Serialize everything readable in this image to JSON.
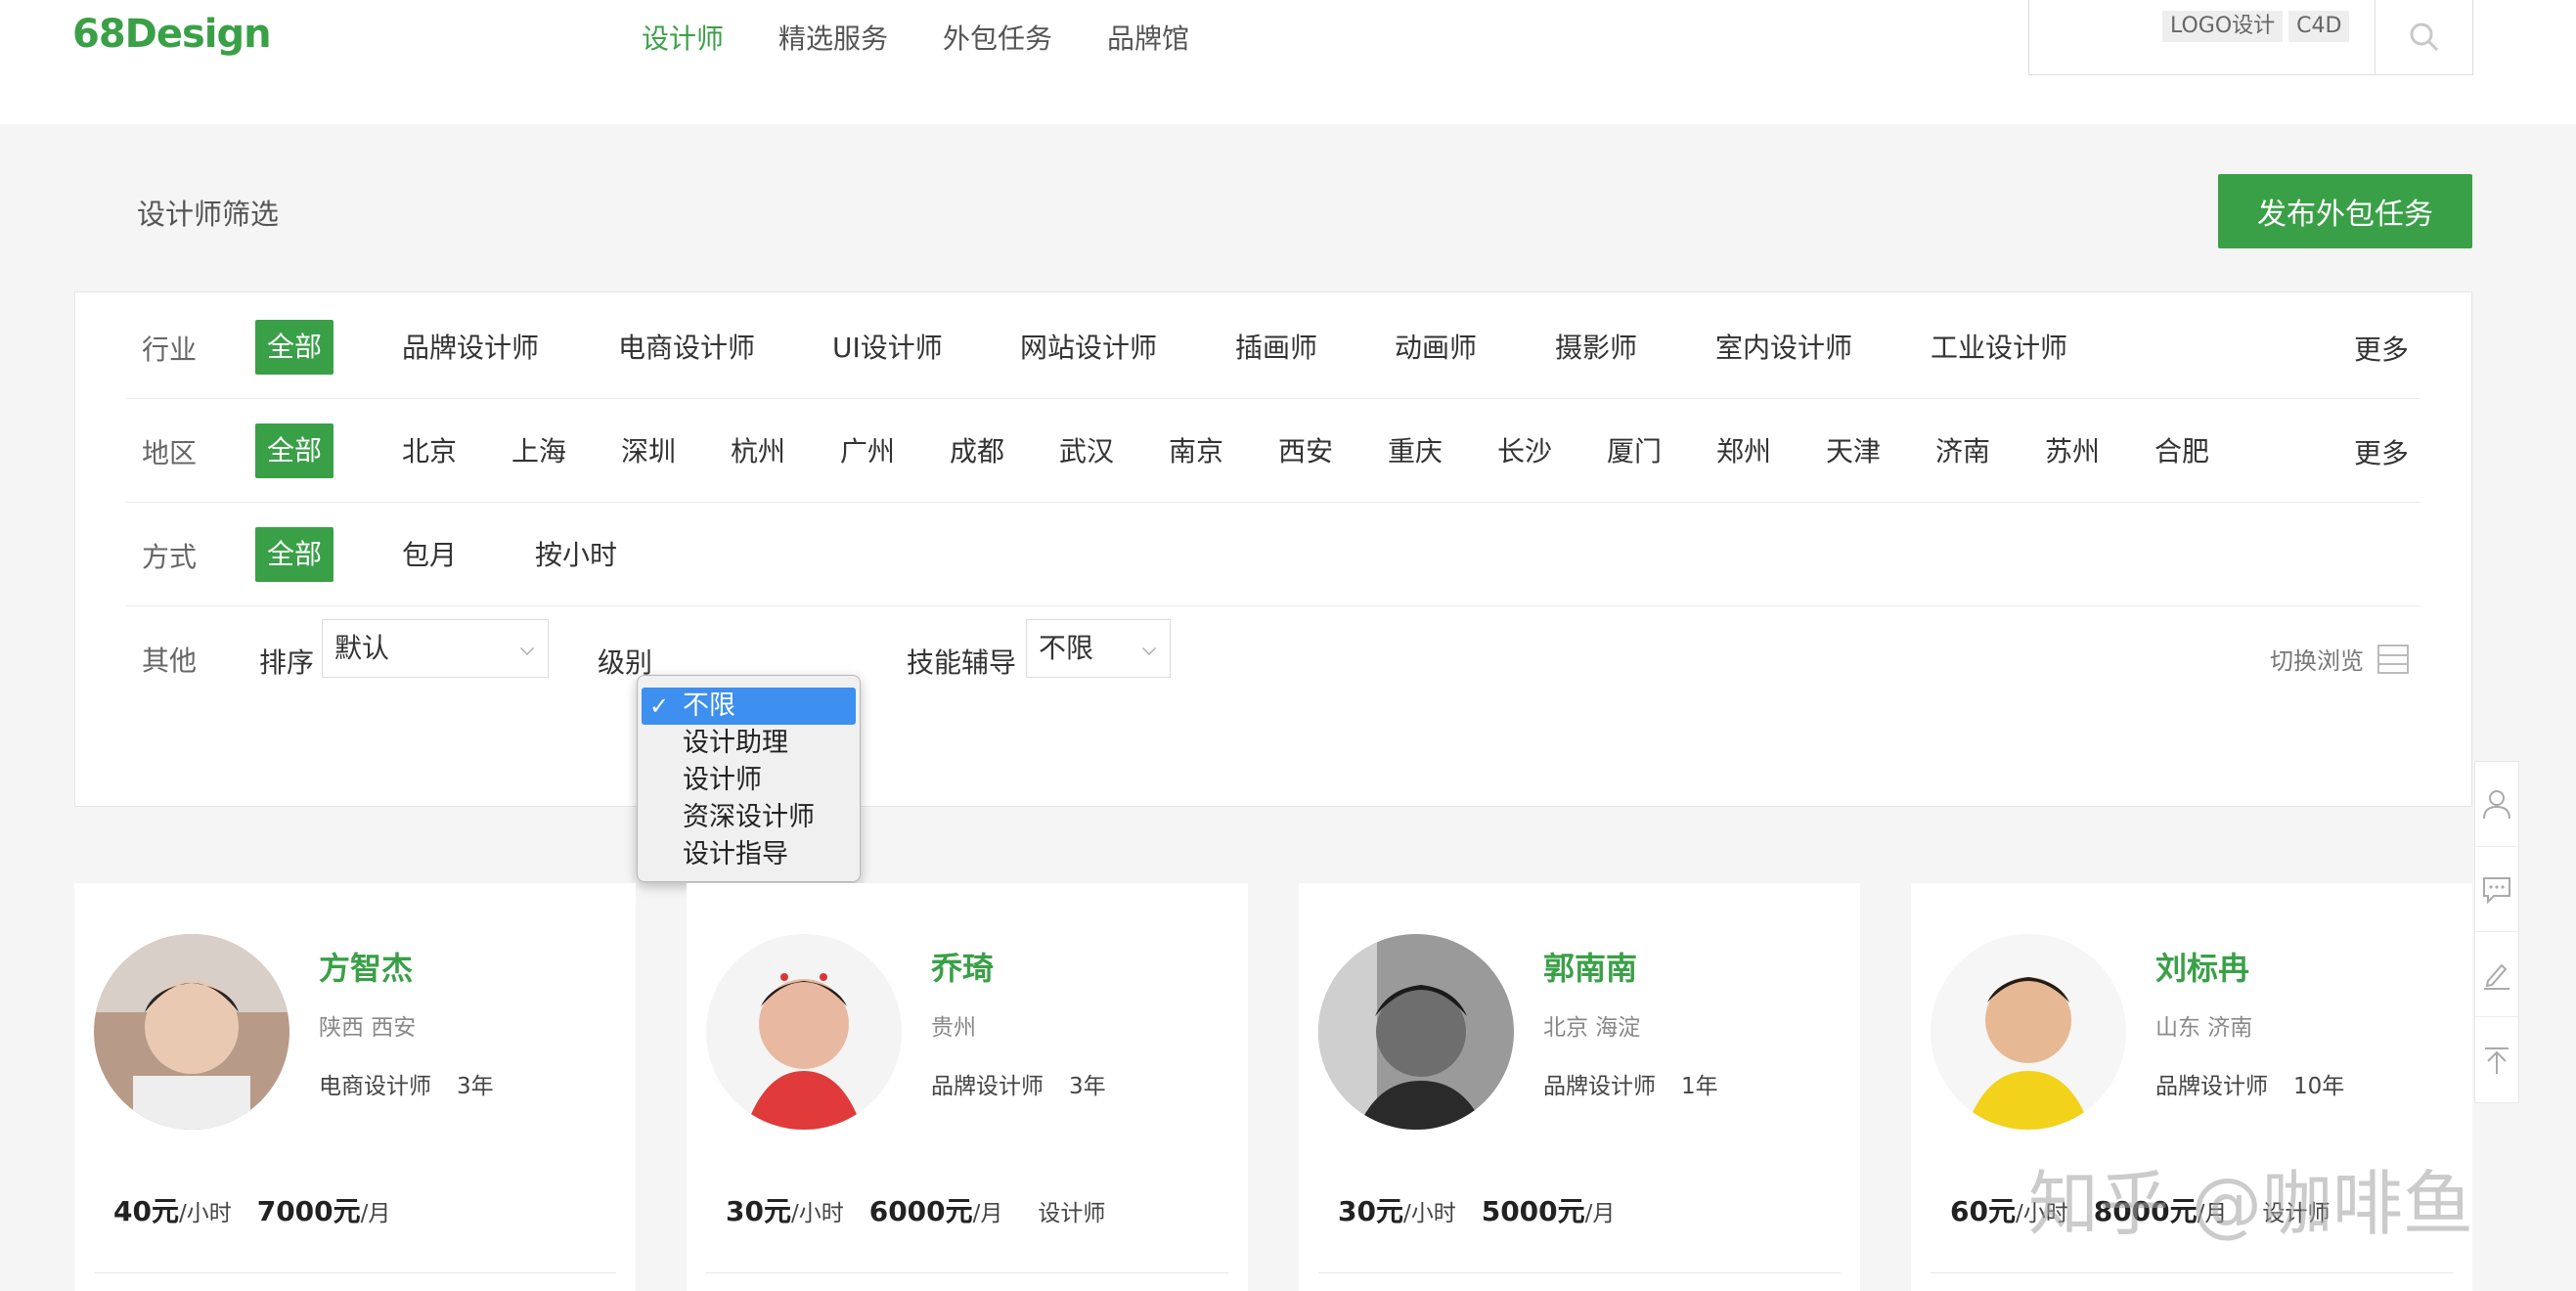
{
  "brand": {
    "logo": "68Design"
  },
  "nav": [
    "设计师",
    "精选服务",
    "外包任务",
    "品牌馆"
  ],
  "search": {
    "hot_tags": [
      "LOGO设计",
      "C4D"
    ]
  },
  "filter_title": "设计师筛选",
  "publish_button": "发布外包任务",
  "filters": {
    "industry": {
      "label": "行业",
      "all": "全部",
      "options": [
        "品牌设计师",
        "电商设计师",
        "UI设计师",
        "网站设计师",
        "插画师",
        "动画师",
        "摄影师",
        "室内设计师",
        "工业设计师"
      ],
      "more": "更多"
    },
    "region": {
      "label": "地区",
      "all": "全部",
      "options": [
        "北京",
        "上海",
        "深圳",
        "杭州",
        "广州",
        "成都",
        "武汉",
        "南京",
        "西安",
        "重庆",
        "长沙",
        "厦门",
        "郑州",
        "天津",
        "济南",
        "苏州",
        "合肥"
      ],
      "more": "更多"
    },
    "mode": {
      "label": "方式",
      "all": "全部",
      "options": [
        "包月",
        "按小时"
      ]
    },
    "other": {
      "label": "其他",
      "sort_label": "排序",
      "sort_value": "默认",
      "level_label": "级别",
      "skill_label": "技能辅导",
      "skill_value": "不限",
      "switch_view": "切换浏览"
    }
  },
  "level_dropdown": {
    "selected": "不限",
    "options": [
      "不限",
      "设计助理",
      "设计师",
      "资深设计师",
      "设计指导"
    ]
  },
  "cards": [
    {
      "name": "方智杰",
      "location": "陕西 西安",
      "role": "电商设计师",
      "years": "3年",
      "hourly": "40元",
      "hourly_unit": "/小时",
      "monthly": "7000元",
      "monthly_unit": "/月",
      "level": ""
    },
    {
      "name": "乔琦",
      "location": "贵州",
      "role": "品牌设计师",
      "years": "3年",
      "hourly": "30元",
      "hourly_unit": "/小时",
      "monthly": "6000元",
      "monthly_unit": "/月",
      "level": "设计师"
    },
    {
      "name": "郭南南",
      "location": "北京 海淀",
      "role": "品牌设计师",
      "years": "1年",
      "hourly": "30元",
      "hourly_unit": "/小时",
      "monthly": "5000元",
      "monthly_unit": "/月",
      "level": ""
    },
    {
      "name": "刘标冉",
      "location": "山东 济南",
      "role": "品牌设计师",
      "years": "10年",
      "hourly": "60元",
      "hourly_unit": "/小时",
      "monthly": "8000元",
      "monthly_unit": "/月",
      "level": "设计师"
    }
  ],
  "side_tools": [
    "user-icon",
    "chat-icon",
    "edit-icon",
    "back-to-top-icon"
  ],
  "watermark": "知乎 @咖啡鱼",
  "colors": {
    "brand_green": "#3aa047",
    "selection_blue": "#3d8ff0"
  }
}
